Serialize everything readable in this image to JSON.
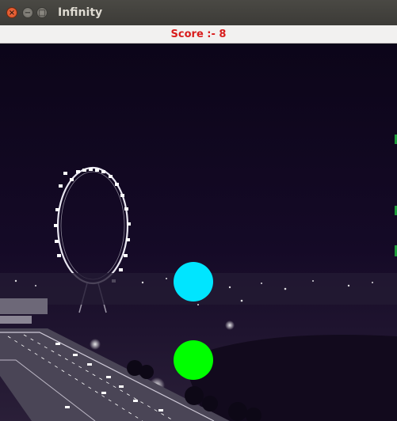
{
  "window": {
    "title": "Infinity",
    "controls": {
      "close_icon": "close-icon",
      "minimize_icon": "minimize-icon",
      "maximize_icon": "maximize-icon"
    }
  },
  "score": {
    "text": "Score :- 8"
  },
  "game": {
    "background": "night city skyline with ferris wheel and highway",
    "balls": [
      {
        "name": "cyan-ball",
        "color": "#00e5ff"
      },
      {
        "name": "green-ball",
        "color": "#00ff00"
      }
    ]
  }
}
